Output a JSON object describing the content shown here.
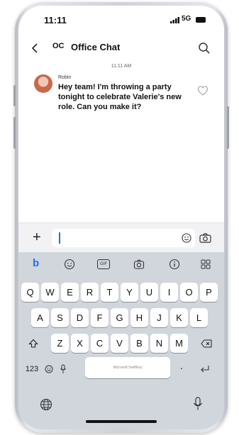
{
  "status_bar": {
    "time": "11:11",
    "network": "5G"
  },
  "header": {
    "back_icon": "chevron-left-icon",
    "avatar_initials": "OC",
    "title": "Office Chat",
    "search_icon": "search-icon"
  },
  "conversation": {
    "timestamp": "11:11 AM",
    "messages": [
      {
        "sender": "Robin",
        "text": "Hey team! I'm throwing a party tonight to celebrate Valerie's new role. Can you make it?",
        "reaction_icon": "heart-outline-icon"
      }
    ]
  },
  "composer": {
    "add_label": "+",
    "value": "",
    "emoji_icon": "emoji-icon",
    "camera_icon": "camera-icon"
  },
  "toolbar": {
    "items": [
      {
        "icon": "bing-icon",
        "label": "b"
      },
      {
        "icon": "emoji-icon"
      },
      {
        "icon": "gif-icon",
        "label": "GIF"
      },
      {
        "icon": "camera-icon"
      },
      {
        "icon": "info-icon"
      },
      {
        "icon": "grid-icon"
      }
    ],
    "brand_color": "#1a73e8"
  },
  "keyboard": {
    "row1": [
      "Q",
      "W",
      "E",
      "R",
      "T",
      "Y",
      "U",
      "I",
      "O",
      "P"
    ],
    "row2": [
      "A",
      "S",
      "D",
      "F",
      "G",
      "H",
      "J",
      "K",
      "L"
    ],
    "row3": [
      "Z",
      "X",
      "C",
      "V",
      "B",
      "N",
      "M"
    ],
    "numbers_label": "123",
    "space_label": "Microsoft SwiftKey",
    "period_label": ".",
    "shift_icon": "shift-icon",
    "backspace_icon": "backspace-icon",
    "return_icon": "return-icon",
    "emoji_icon": "emoji-icon",
    "mic_icon": "microphone-icon",
    "globe_icon": "globe-icon"
  }
}
